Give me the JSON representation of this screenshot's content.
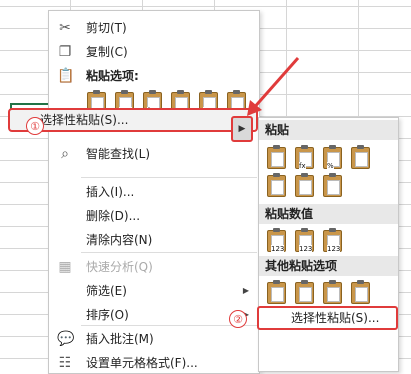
{
  "menu": {
    "cut": "剪切(T)",
    "copy": "复制(C)",
    "paste_options_header": "粘贴选项:",
    "paste_special": "选择性粘贴(S)...",
    "smart_lookup": "智能查找(L)",
    "insert": "插入(I)...",
    "delete": "删除(D)...",
    "clear_contents": "清除内容(N)",
    "quick_analysis": "快速分析(Q)",
    "filter": "筛选(E)",
    "sort": "排序(O)",
    "insert_comment": "插入批注(M)",
    "format_cells": "设置单元格格式(F)..."
  },
  "submenu": {
    "paste_header": "粘贴",
    "values_header": "粘贴数值",
    "other_header": "其他粘贴选项",
    "paste_special": "选择性粘贴(S)..."
  },
  "annotations": {
    "step1": "①",
    "step2": "②"
  },
  "icon_tags": {
    "n123": "123",
    "percent": "%",
    "fx": "fx"
  },
  "colors": {
    "highlight": "#e03b3b",
    "clipboard": "#c9964a"
  }
}
